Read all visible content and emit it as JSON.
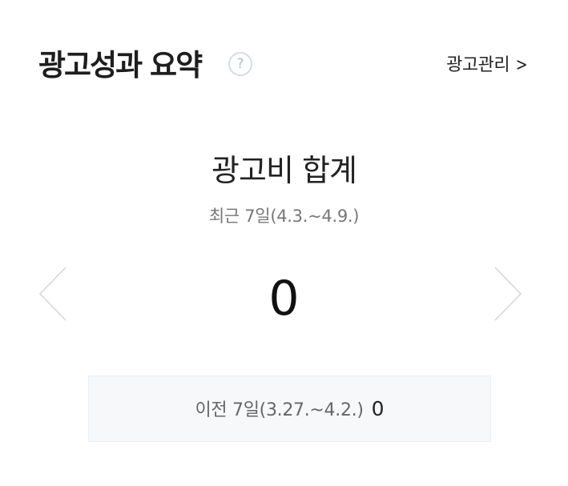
{
  "header": {
    "title": "광고성과 요약",
    "help_icon": "?",
    "manage_link_label": "광고관리",
    "manage_link_icon": "chevron-right-icon"
  },
  "summary": {
    "title": "광고비 합계",
    "period": "최근 7일(4.3.~4.9.)",
    "total_value": "0",
    "prev_icon": "chevron-left-icon",
    "next_icon": "chevron-right-icon"
  },
  "previous": {
    "label": "이전 7일(3.27.~4.2.)",
    "value": "0"
  },
  "colors": {
    "box_background": "#f7f8fa",
    "arrow": "#d4d7dc",
    "help_icon": "#b6bec9"
  }
}
